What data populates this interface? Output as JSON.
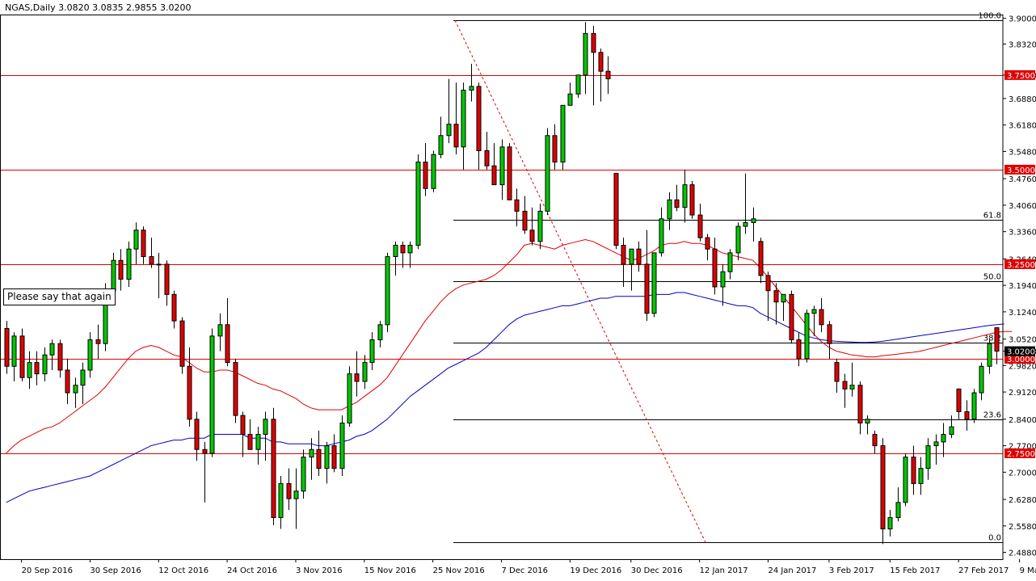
{
  "chart_data": {
    "type": "candlestick",
    "title": "NGAS,Daily  3.0820 3.0835 2.9855 3.0200",
    "ylim": [
      2.47,
      3.91
    ],
    "y_ticks": [
      "3.9000",
      "3.8320",
      "3.7500",
      "3.6880",
      "3.6180",
      "3.5480",
      "3.4760",
      "3.4060",
      "3.3360",
      "3.2640",
      "3.1940",
      "3.1240",
      "3.0520",
      "3.0200",
      "2.9820",
      "2.9120",
      "2.8400",
      "2.7700",
      "2.7000",
      "2.6280",
      "2.5580",
      "2.4880"
    ],
    "x_labels": [
      "20 Sep 2016",
      "30 Sep 2016",
      "12 Oct 2016",
      "24 Oct 2016",
      "3 Nov 2016",
      "15 Nov 2016",
      "25 Nov 2016",
      "7 Dec 2016",
      "19 Dec 2016",
      "30 Dec 2016",
      "12 Jan 2017",
      "24 Jan 2017",
      "3 Feb 2017",
      "15 Feb 2017",
      "27 Feb 2017",
      "9 Mar 2017"
    ],
    "horizontal_levels": [
      {
        "value": 3.75,
        "label": "3.7500"
      },
      {
        "value": 3.5,
        "label": "3.5000"
      },
      {
        "value": 3.25,
        "label": "3.2500"
      },
      {
        "value": 3.0,
        "label": "3.0000"
      },
      {
        "value": 2.75,
        "label": "2.7500"
      }
    ],
    "fibonacci": {
      "high": 3.895,
      "low": 2.515,
      "levels": [
        {
          "value": 3.895,
          "label": "100.0"
        },
        {
          "value": 3.368,
          "label": "61.8"
        },
        {
          "value": 3.205,
          "label": "50.0"
        },
        {
          "value": 3.043,
          "label": "38.2"
        },
        {
          "value": 2.84,
          "label": "23.6"
        },
        {
          "value": 2.515,
          "label": "0.0"
        }
      ]
    },
    "current_price": {
      "value": 3.02,
      "label": "3.0200"
    },
    "annotation": "Please say that again",
    "candles": [
      [
        3.08,
        3.1,
        2.96,
        2.98
      ],
      [
        2.98,
        3.07,
        2.94,
        3.06
      ],
      [
        3.06,
        3.08,
        2.94,
        2.95
      ],
      [
        2.95,
        3.02,
        2.92,
        2.99
      ],
      [
        2.99,
        3.02,
        2.93,
        2.96
      ],
      [
        2.96,
        3.03,
        2.94,
        3.01
      ],
      [
        3.01,
        3.05,
        2.97,
        3.04
      ],
      [
        3.04,
        3.05,
        2.95,
        2.97
      ],
      [
        2.97,
        3.0,
        2.88,
        2.91
      ],
      [
        2.91,
        2.95,
        2.87,
        2.93
      ],
      [
        2.93,
        2.99,
        2.88,
        2.97
      ],
      [
        2.97,
        3.07,
        2.95,
        3.05
      ],
      [
        3.05,
        3.09,
        3.0,
        3.04
      ],
      [
        3.04,
        3.2,
        3.02,
        3.18
      ],
      [
        3.18,
        3.28,
        3.15,
        3.26
      ],
      [
        3.26,
        3.29,
        3.18,
        3.21
      ],
      [
        3.21,
        3.31,
        3.19,
        3.29
      ],
      [
        3.29,
        3.36,
        3.25,
        3.34
      ],
      [
        3.34,
        3.35,
        3.25,
        3.27
      ],
      [
        3.27,
        3.32,
        3.24,
        3.25
      ],
      [
        3.25,
        3.28,
        3.16,
        3.25
      ],
      [
        3.25,
        3.26,
        3.14,
        3.17
      ],
      [
        3.17,
        3.18,
        3.08,
        3.1
      ],
      [
        3.1,
        3.11,
        2.96,
        2.98
      ],
      [
        2.98,
        3.03,
        2.82,
        2.84
      ],
      [
        2.84,
        2.86,
        2.73,
        2.76
      ],
      [
        2.76,
        2.78,
        2.62,
        2.75
      ],
      [
        2.75,
        3.08,
        2.74,
        3.06
      ],
      [
        3.06,
        3.12,
        3.02,
        3.09
      ],
      [
        3.09,
        3.16,
        2.98,
        2.99
      ],
      [
        2.99,
        3.0,
        2.83,
        2.85
      ],
      [
        2.85,
        2.86,
        2.74,
        2.8
      ],
      [
        2.8,
        2.84,
        2.76,
        2.76
      ],
      [
        2.76,
        2.82,
        2.72,
        2.8
      ],
      [
        2.8,
        2.86,
        2.73,
        2.84
      ],
      [
        2.84,
        2.87,
        2.56,
        2.58
      ],
      [
        2.58,
        2.69,
        2.55,
        2.67
      ],
      [
        2.67,
        2.71,
        2.6,
        2.63
      ],
      [
        2.63,
        2.71,
        2.55,
        2.65
      ],
      [
        2.65,
        2.76,
        2.63,
        2.74
      ],
      [
        2.74,
        2.79,
        2.68,
        2.76
      ],
      [
        2.76,
        2.81,
        2.69,
        2.71
      ],
      [
        2.71,
        2.78,
        2.67,
        2.77
      ],
      [
        2.77,
        2.8,
        2.7,
        2.71
      ],
      [
        2.71,
        2.85,
        2.69,
        2.83
      ],
      [
        2.83,
        2.98,
        2.82,
        2.96
      ],
      [
        2.96,
        3.02,
        2.9,
        2.94
      ],
      [
        2.94,
        3.01,
        2.92,
        2.99
      ],
      [
        2.99,
        3.07,
        2.97,
        3.05
      ],
      [
        3.05,
        3.1,
        3.03,
        3.09
      ],
      [
        3.09,
        3.28,
        3.07,
        3.27
      ],
      [
        3.27,
        3.31,
        3.22,
        3.3
      ],
      [
        3.3,
        3.31,
        3.24,
        3.28
      ],
      [
        3.28,
        3.31,
        3.24,
        3.3
      ],
      [
        3.3,
        3.54,
        3.29,
        3.52
      ],
      [
        3.52,
        3.57,
        3.43,
        3.45
      ],
      [
        3.45,
        3.55,
        3.44,
        3.54
      ],
      [
        3.54,
        3.64,
        3.53,
        3.59
      ],
      [
        3.59,
        3.74,
        3.57,
        3.62
      ],
      [
        3.62,
        3.73,
        3.54,
        3.56
      ],
      [
        3.56,
        3.73,
        3.5,
        3.71
      ],
      [
        3.71,
        3.78,
        3.68,
        3.72
      ],
      [
        3.72,
        3.73,
        3.5,
        3.55
      ],
      [
        3.55,
        3.6,
        3.5,
        3.51
      ],
      [
        3.51,
        3.57,
        3.48,
        3.46
      ],
      [
        3.46,
        3.58,
        3.42,
        3.56
      ],
      [
        3.56,
        3.57,
        3.44,
        3.42
      ],
      [
        3.42,
        3.45,
        3.35,
        3.39
      ],
      [
        3.39,
        3.43,
        3.33,
        3.34
      ],
      [
        3.34,
        3.4,
        3.3,
        3.31
      ],
      [
        3.31,
        3.41,
        3.29,
        3.39
      ],
      [
        3.39,
        3.61,
        3.38,
        3.59
      ],
      [
        3.59,
        3.62,
        3.5,
        3.52
      ],
      [
        3.52,
        3.67,
        3.5,
        3.67
      ],
      [
        3.67,
        3.73,
        3.68,
        3.7
      ],
      [
        3.7,
        3.75,
        3.69,
        3.75
      ],
      [
        3.75,
        3.89,
        3.7,
        3.86
      ],
      [
        3.86,
        3.88,
        3.67,
        3.81
      ],
      [
        3.81,
        3.82,
        3.68,
        3.76
      ],
      [
        3.76,
        3.8,
        3.7,
        3.74
      ],
      [
        3.49,
        3.49,
        3.29,
        3.3
      ],
      [
        3.3,
        3.32,
        3.19,
        3.25
      ],
      [
        3.25,
        3.28,
        3.18,
        3.29
      ],
      [
        3.29,
        3.31,
        3.23,
        3.25
      ],
      [
        3.25,
        3.34,
        3.1,
        3.12
      ],
      [
        3.12,
        3.28,
        3.11,
        3.28
      ],
      [
        3.28,
        3.4,
        3.27,
        3.37
      ],
      [
        3.37,
        3.44,
        3.34,
        3.42
      ],
      [
        3.42,
        3.46,
        3.39,
        3.4
      ],
      [
        3.4,
        3.5,
        3.36,
        3.46
      ],
      [
        3.46,
        3.47,
        3.37,
        3.38
      ],
      [
        3.38,
        3.41,
        3.31,
        3.32
      ],
      [
        3.32,
        3.33,
        3.26,
        3.29
      ],
      [
        3.29,
        3.32,
        3.17,
        3.19
      ],
      [
        3.19,
        3.25,
        3.14,
        3.23
      ],
      [
        3.23,
        3.29,
        3.21,
        3.28
      ],
      [
        3.28,
        3.36,
        3.26,
        3.35
      ],
      [
        3.35,
        3.49,
        3.33,
        3.36
      ],
      [
        3.36,
        3.4,
        3.31,
        3.37
      ],
      [
        3.31,
        3.32,
        3.2,
        3.22
      ],
      [
        3.22,
        3.23,
        3.1,
        3.18
      ],
      [
        3.18,
        3.2,
        3.09,
        3.15
      ],
      [
        3.15,
        3.17,
        3.1,
        3.17
      ],
      [
        3.17,
        3.18,
        3.04,
        3.05
      ],
      [
        3.05,
        3.07,
        2.98,
        3.0
      ],
      [
        3.0,
        3.13,
        2.99,
        3.12
      ],
      [
        3.12,
        3.14,
        3.06,
        3.13
      ],
      [
        3.13,
        3.16,
        3.07,
        3.09
      ],
      [
        3.09,
        3.1,
        3.0,
        3.04
      ],
      [
        2.99,
        3.0,
        2.91,
        2.94
      ],
      [
        2.94,
        2.96,
        2.87,
        2.92
      ],
      [
        2.92,
        2.99,
        2.9,
        2.93
      ],
      [
        2.93,
        2.94,
        2.8,
        2.83
      ],
      [
        2.83,
        2.85,
        2.8,
        2.84
      ],
      [
        2.8,
        2.81,
        2.75,
        2.77
      ],
      [
        2.77,
        2.79,
        2.51,
        2.55
      ],
      [
        2.55,
        2.6,
        2.53,
        2.58
      ],
      [
        2.58,
        2.66,
        2.57,
        2.62
      ],
      [
        2.62,
        2.75,
        2.61,
        2.74
      ],
      [
        2.74,
        2.77,
        2.64,
        2.67
      ],
      [
        2.67,
        2.74,
        2.64,
        2.71
      ],
      [
        2.71,
        2.79,
        2.68,
        2.77
      ],
      [
        2.77,
        2.8,
        2.72,
        2.78
      ],
      [
        2.78,
        2.83,
        2.74,
        2.8
      ],
      [
        2.8,
        2.85,
        2.79,
        2.82
      ],
      [
        2.92,
        2.92,
        2.84,
        2.86
      ],
      [
        2.86,
        2.89,
        2.81,
        2.84
      ],
      [
        2.84,
        2.92,
        2.83,
        2.91
      ],
      [
        2.91,
        2.99,
        2.89,
        2.98
      ],
      [
        2.98,
        3.05,
        2.96,
        3.04
      ],
      [
        3.082,
        3.0835,
        2.9855,
        3.02
      ]
    ],
    "series": [
      {
        "name": "",
        "color": "#e00000",
        "values": [
          2.75,
          2.77,
          2.785,
          2.795,
          2.805,
          2.815,
          2.82,
          2.83,
          2.845,
          2.86,
          2.875,
          2.89,
          2.905,
          2.925,
          2.95,
          2.975,
          3.0,
          3.02,
          3.03,
          3.035,
          3.03,
          3.02,
          3.01,
          3.005,
          2.99,
          2.975,
          2.965,
          2.965,
          2.97,
          2.97,
          2.965,
          2.955,
          2.945,
          2.935,
          2.93,
          2.92,
          2.915,
          2.905,
          2.895,
          2.88,
          2.87,
          2.865,
          2.865,
          2.865,
          2.865,
          2.875,
          2.885,
          2.9,
          2.915,
          2.93,
          2.95,
          2.98,
          3.01,
          3.04,
          3.07,
          3.1,
          3.125,
          3.15,
          3.17,
          3.185,
          3.195,
          3.2,
          3.205,
          3.21,
          3.22,
          3.235,
          3.255,
          3.275,
          3.3,
          3.305,
          3.3,
          3.295,
          3.29,
          3.3,
          3.305,
          3.31,
          3.315,
          3.31,
          3.3,
          3.29,
          3.28,
          3.27,
          3.26,
          3.265,
          3.275,
          3.285,
          3.3,
          3.305,
          3.305,
          3.31,
          3.305,
          3.305,
          3.3,
          3.29,
          3.28,
          3.275,
          3.27,
          3.265,
          3.26,
          3.24,
          3.215,
          3.19,
          3.165,
          3.14,
          3.115,
          3.09,
          3.065,
          3.045,
          3.03,
          3.02,
          3.015,
          3.01,
          3.008,
          3.005,
          3.005,
          3.008,
          3.01,
          3.012,
          3.015,
          3.017,
          3.02,
          3.025,
          3.03,
          3.035,
          3.04,
          3.045,
          3.05,
          3.055,
          3.06,
          3.065,
          3.07,
          3.072,
          3.072
        ]
      },
      {
        "name": "",
        "color": "#0000c0",
        "values": [
          2.62,
          2.63,
          2.64,
          2.65,
          2.655,
          2.66,
          2.665,
          2.67,
          2.675,
          2.68,
          2.685,
          2.69,
          2.7,
          2.71,
          2.72,
          2.73,
          2.74,
          2.75,
          2.76,
          2.77,
          2.775,
          2.78,
          2.785,
          2.785,
          2.79,
          2.79,
          2.79,
          2.8,
          2.8,
          2.8,
          2.8,
          2.8,
          2.79,
          2.79,
          2.79,
          2.78,
          2.78,
          2.775,
          2.775,
          2.775,
          2.775,
          2.77,
          2.77,
          2.775,
          2.78,
          2.785,
          2.795,
          2.8,
          2.81,
          2.825,
          2.84,
          2.86,
          2.88,
          2.9,
          2.915,
          2.93,
          2.945,
          2.96,
          2.975,
          2.985,
          2.995,
          3.005,
          3.015,
          3.03,
          3.05,
          3.07,
          3.09,
          3.105,
          3.115,
          3.12,
          3.125,
          3.13,
          3.135,
          3.14,
          3.14,
          3.145,
          3.15,
          3.155,
          3.16,
          3.16,
          3.165,
          3.165,
          3.165,
          3.165,
          3.165,
          3.17,
          3.17,
          3.17,
          3.175,
          3.175,
          3.17,
          3.165,
          3.16,
          3.155,
          3.15,
          3.145,
          3.14,
          3.14,
          3.135,
          3.12,
          3.11,
          3.1,
          3.09,
          3.08,
          3.07,
          3.06,
          3.055,
          3.05,
          3.048,
          3.046,
          3.045,
          3.044,
          3.043,
          3.043,
          3.044,
          3.046,
          3.049,
          3.052,
          3.055,
          3.058,
          3.061,
          3.064,
          3.067,
          3.07,
          3.073,
          3.076,
          3.079,
          3.082,
          3.085,
          3.088,
          3.09,
          3.092
        ]
      }
    ]
  }
}
